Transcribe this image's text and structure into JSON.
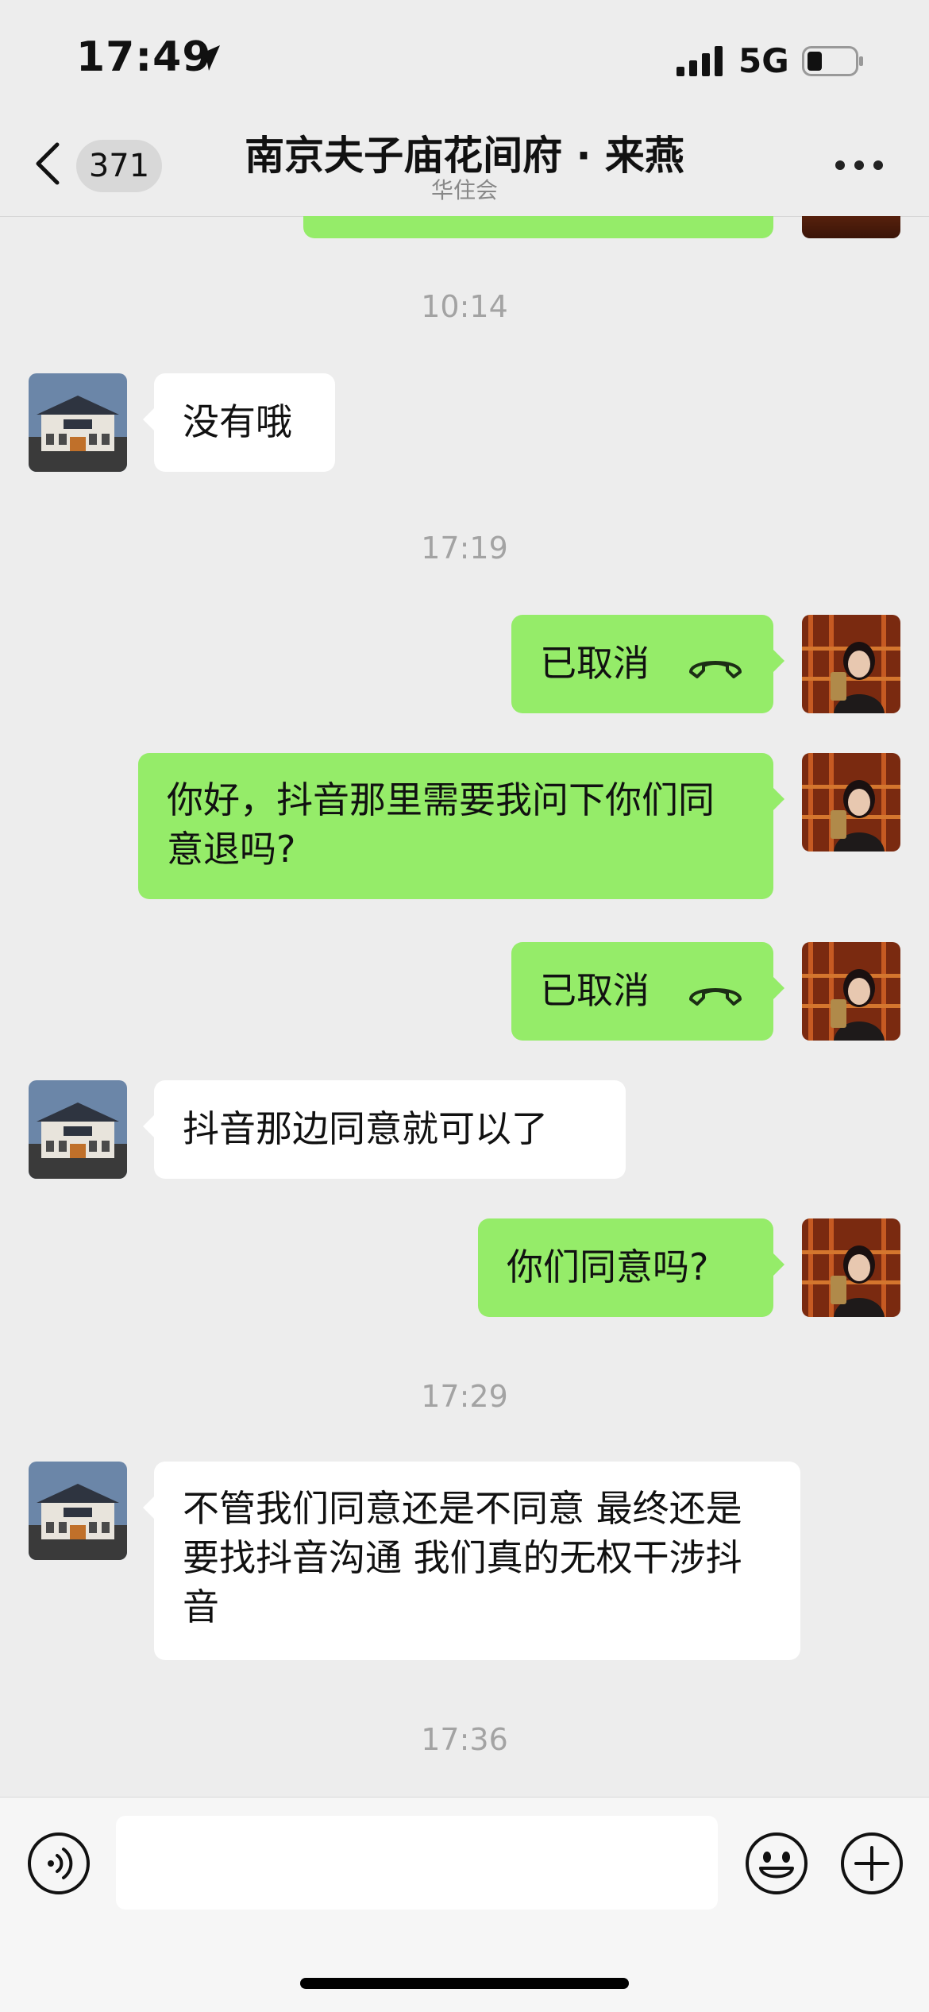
{
  "status_bar": {
    "time": "17:49",
    "network": "5G",
    "icons": [
      "location-arrow-icon",
      "signal-icon",
      "battery-icon"
    ]
  },
  "header": {
    "back_icon": "chevron-left-icon",
    "unread_count": "371",
    "title": "南京夫子庙花间府 · 来燕",
    "subtitle": "华住会",
    "more_icon": "more-dots-icon"
  },
  "messages": [
    {
      "type": "time",
      "text": "10:14"
    },
    {
      "type": "incoming",
      "text": "没有哦"
    },
    {
      "type": "time",
      "text": "17:19"
    },
    {
      "type": "outgoing-call",
      "text": "已取消",
      "icon": "phone-hangup-icon"
    },
    {
      "type": "outgoing",
      "text": "你好，抖音那里需要我问下你们同意退吗?"
    },
    {
      "type": "outgoing-call",
      "text": "已取消",
      "icon": "phone-hangup-icon"
    },
    {
      "type": "incoming",
      "text": "抖音那边同意就可以了"
    },
    {
      "type": "outgoing",
      "text": "你们同意吗?"
    },
    {
      "type": "time",
      "text": "17:29"
    },
    {
      "type": "incoming",
      "text": "不管我们同意还是不同意 最终还是要找抖音沟通 我们真的无权干涉抖音"
    },
    {
      "type": "time",
      "text": "17:36"
    }
  ],
  "input_bar": {
    "voice_icon": "voice-icon",
    "input_value": "",
    "emoji_icon": "emoji-icon",
    "plus_icon": "plus-circle-icon"
  },
  "colors": {
    "outgoing_bubble": "#95ec69",
    "incoming_bubble": "#ffffff",
    "background": "#ededed"
  }
}
